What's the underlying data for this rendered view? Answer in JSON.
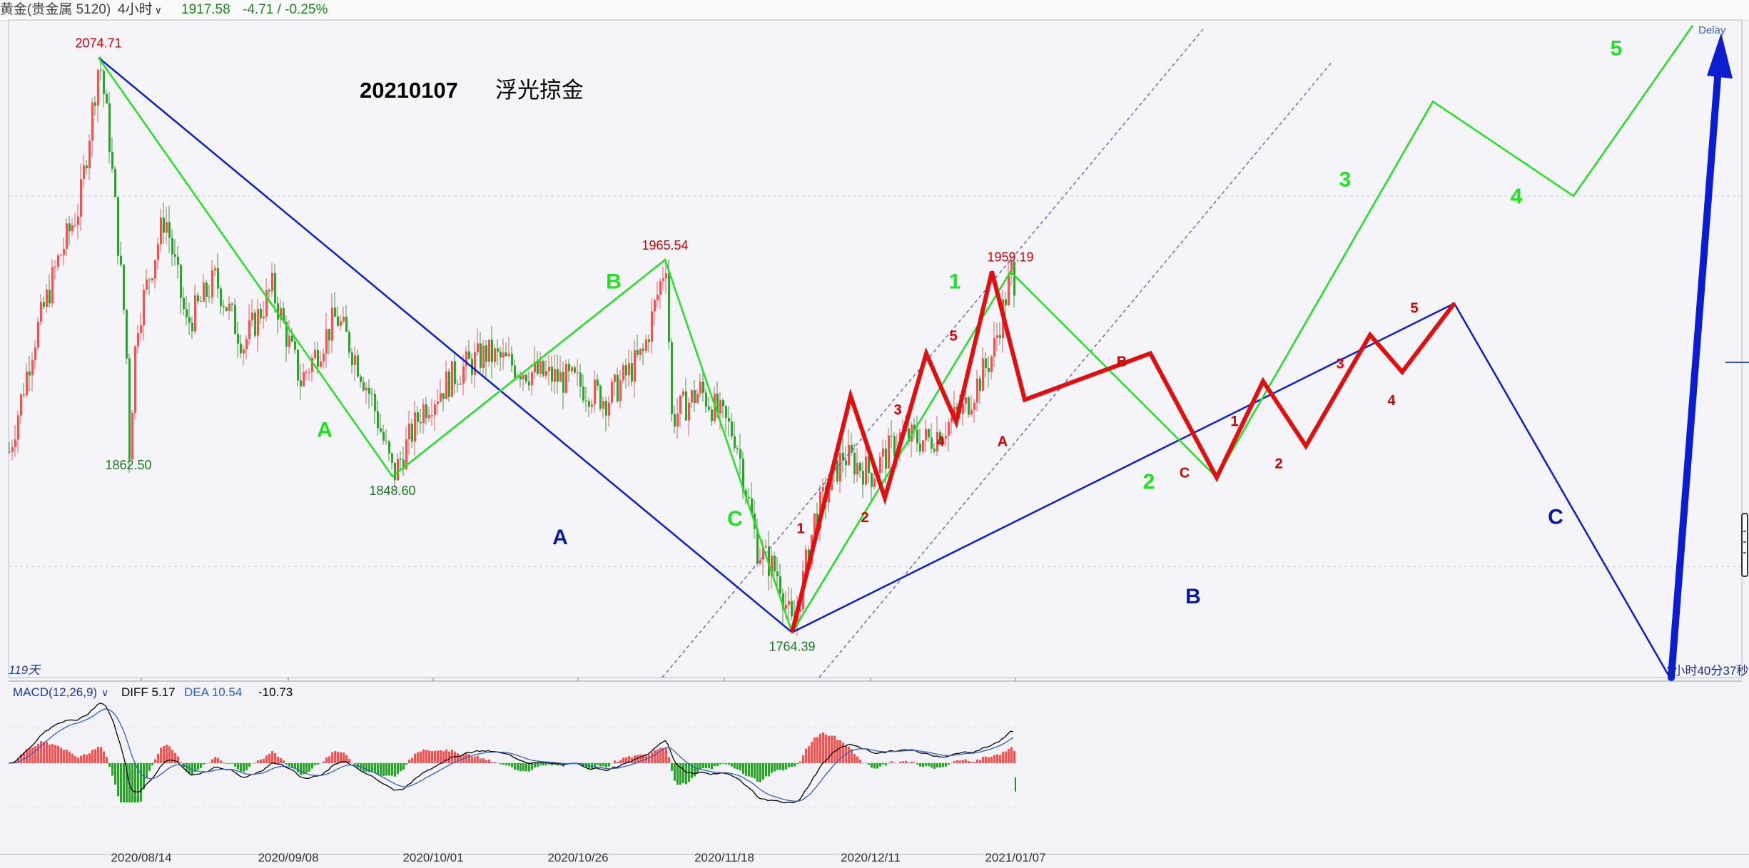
{
  "header": {
    "instrument": "黄金(贵金属 5120)",
    "period": "4小时",
    "last_price": "1917.58",
    "change": "-4.71 / -0.25%"
  },
  "annotation": {
    "date": "20210107",
    "author": "浮光掠金"
  },
  "status": {
    "days": "119天",
    "countdown": "3小时40分37秒",
    "delay": "Delay"
  },
  "macd": {
    "title": "MACD(12,26,9)",
    "diff_label": "DIFF 5.17",
    "dea_label": "DEA 10.54",
    "macd_value": "-10.73"
  },
  "colors": {
    "up": "#e05a5a",
    "down": "#3a9a3a",
    "wave_green": "#22e022",
    "wave_blue": "#0a1ed0",
    "wave_red": "#e01010",
    "label_green": "#1a7a1a",
    "label_red": "#d00000",
    "label_blue": "#0a1aa0"
  },
  "chart_data": {
    "type": "candlestick",
    "x_dates": [
      "2020/08/14",
      "2020/09/08",
      "2020/10/01",
      "2020/10/26",
      "2020/11/18",
      "2020/12/11",
      "2021/01/07"
    ],
    "ylim": [
      1740,
      2095
    ],
    "price_labels": [
      {
        "value": 2074.71,
        "bar": 138
      },
      {
        "value": 1862.5,
        "bar": 180
      },
      {
        "value": 1848.6,
        "bar": 550
      },
      {
        "value": 1965.54,
        "bar": 932
      },
      {
        "value": 1764.39,
        "bar": 1110
      },
      {
        "value": 1959.19,
        "bar": 1416
      }
    ],
    "wave_labels": [
      {
        "text": "A",
        "color": "green",
        "bar": 455,
        "price": 1870
      },
      {
        "text": "B",
        "color": "green",
        "bar": 860,
        "price": 1950
      },
      {
        "text": "C",
        "color": "green",
        "bar": 1030,
        "price": 1822
      },
      {
        "text": "A",
        "color": "blue",
        "bar": 785,
        "price": 1812
      },
      {
        "text": "1",
        "color": "green",
        "bar": 1338,
        "price": 1950
      },
      {
        "text": "2",
        "color": "green",
        "bar": 1610,
        "price": 1842
      },
      {
        "text": "3",
        "color": "green",
        "bar": 1885,
        "price": 2005
      },
      {
        "text": "4",
        "color": "green",
        "bar": 2125,
        "price": 1996
      },
      {
        "text": "5",
        "color": "green",
        "bar": 2265,
        "price": 2076
      },
      {
        "text": "B",
        "color": "blue",
        "bar": 1672,
        "price": 1780
      },
      {
        "text": "C",
        "color": "blue",
        "bar": 2180,
        "price": 1823
      },
      {
        "text": "1",
        "color": "red",
        "bar": 1122,
        "price": 1818
      },
      {
        "text": "2",
        "color": "red",
        "bar": 1212,
        "price": 1824
      },
      {
        "text": "3",
        "color": "red",
        "bar": 1258,
        "price": 1882
      },
      {
        "text": "4",
        "color": "red",
        "bar": 1318,
        "price": 1865
      },
      {
        "text": "5",
        "color": "red",
        "bar": 1336,
        "price": 1922
      },
      {
        "text": "A",
        "color": "red",
        "bar": 1405,
        "price": 1865
      },
      {
        "text": "B",
        "color": "red",
        "bar": 1572,
        "price": 1908
      },
      {
        "text": "C",
        "color": "red",
        "bar": 1660,
        "price": 1848
      },
      {
        "text": "1",
        "color": "red",
        "bar": 1730,
        "price": 1876
      },
      {
        "text": "2",
        "color": "red",
        "bar": 1792,
        "price": 1853
      },
      {
        "text": "3",
        "color": "red",
        "bar": 1878,
        "price": 1907
      },
      {
        "text": "4",
        "color": "red",
        "bar": 1950,
        "price": 1887
      },
      {
        "text": "5",
        "color": "red",
        "bar": 1982,
        "price": 1937
      }
    ],
    "wave_lines": {
      "blue": [
        [
          138,
          2074.71
        ],
        [
          1110,
          1764.39
        ],
        [
          2038,
          1942
        ],
        [
          2340,
          1740
        ]
      ],
      "green": [
        [
          138,
          2074.71
        ],
        [
          550,
          1848.6
        ],
        [
          932,
          1965.54
        ],
        [
          1110,
          1764.39
        ],
        [
          1416,
          1959.19
        ],
        [
          1705,
          1848
        ],
        [
          2008,
          2051
        ],
        [
          2205,
          2000
        ],
        [
          2372,
          2092
        ]
      ],
      "red": [
        [
          1110,
          1764.39
        ],
        [
          1192,
          1892
        ],
        [
          1240,
          1837
        ],
        [
          1298,
          1915
        ],
        [
          1340,
          1878
        ],
        [
          1390,
          1959.19
        ],
        [
          1436,
          1890
        ],
        [
          1612,
          1915
        ],
        [
          1705,
          1848
        ],
        [
          1770,
          1900
        ],
        [
          1830,
          1865
        ],
        [
          1920,
          1925
        ],
        [
          1965,
          1905
        ],
        [
          2038,
          1942
        ]
      ],
      "blue_arrow": [
        [
          2342,
          1740
        ],
        [
          2410,
          2088
        ]
      ]
    },
    "channel_lines": [
      [
        [
          928,
          1740
        ],
        [
          1686,
          2090
        ]
      ],
      [
        [
          1148,
          1740
        ],
        [
          1868,
          2073
        ]
      ]
    ]
  }
}
